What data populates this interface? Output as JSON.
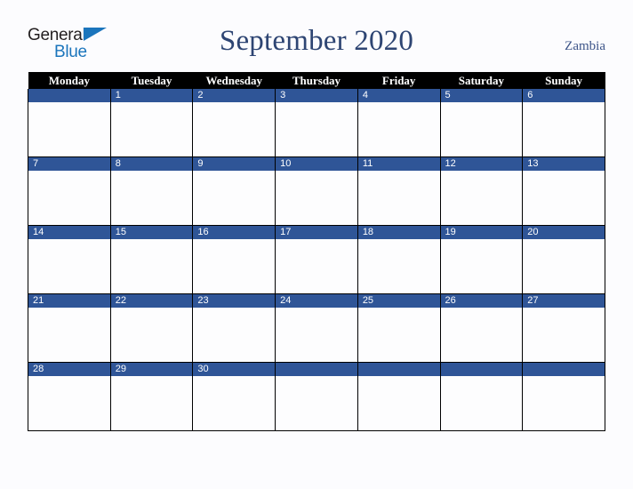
{
  "brand": {
    "name_top": "General",
    "name_bottom": "Blue"
  },
  "header": {
    "title": "September 2020",
    "region": "Zambia"
  },
  "colors": {
    "title_navy": "#2e4573",
    "day_band_blue": "#2f5597",
    "header_row_black": "#000000",
    "logo_blue": "#1b75bc",
    "page_background": "#fcfcfe"
  },
  "calendar": {
    "weekday_headers": [
      "Monday",
      "Tuesday",
      "Wednesday",
      "Thursday",
      "Friday",
      "Saturday",
      "Sunday"
    ],
    "weeks": [
      [
        "",
        "1",
        "2",
        "3",
        "4",
        "5",
        "6"
      ],
      [
        "7",
        "8",
        "9",
        "10",
        "11",
        "12",
        "13"
      ],
      [
        "14",
        "15",
        "16",
        "17",
        "18",
        "19",
        "20"
      ],
      [
        "21",
        "22",
        "23",
        "24",
        "25",
        "26",
        "27"
      ],
      [
        "28",
        "29",
        "30",
        "",
        "",
        "",
        ""
      ]
    ]
  }
}
